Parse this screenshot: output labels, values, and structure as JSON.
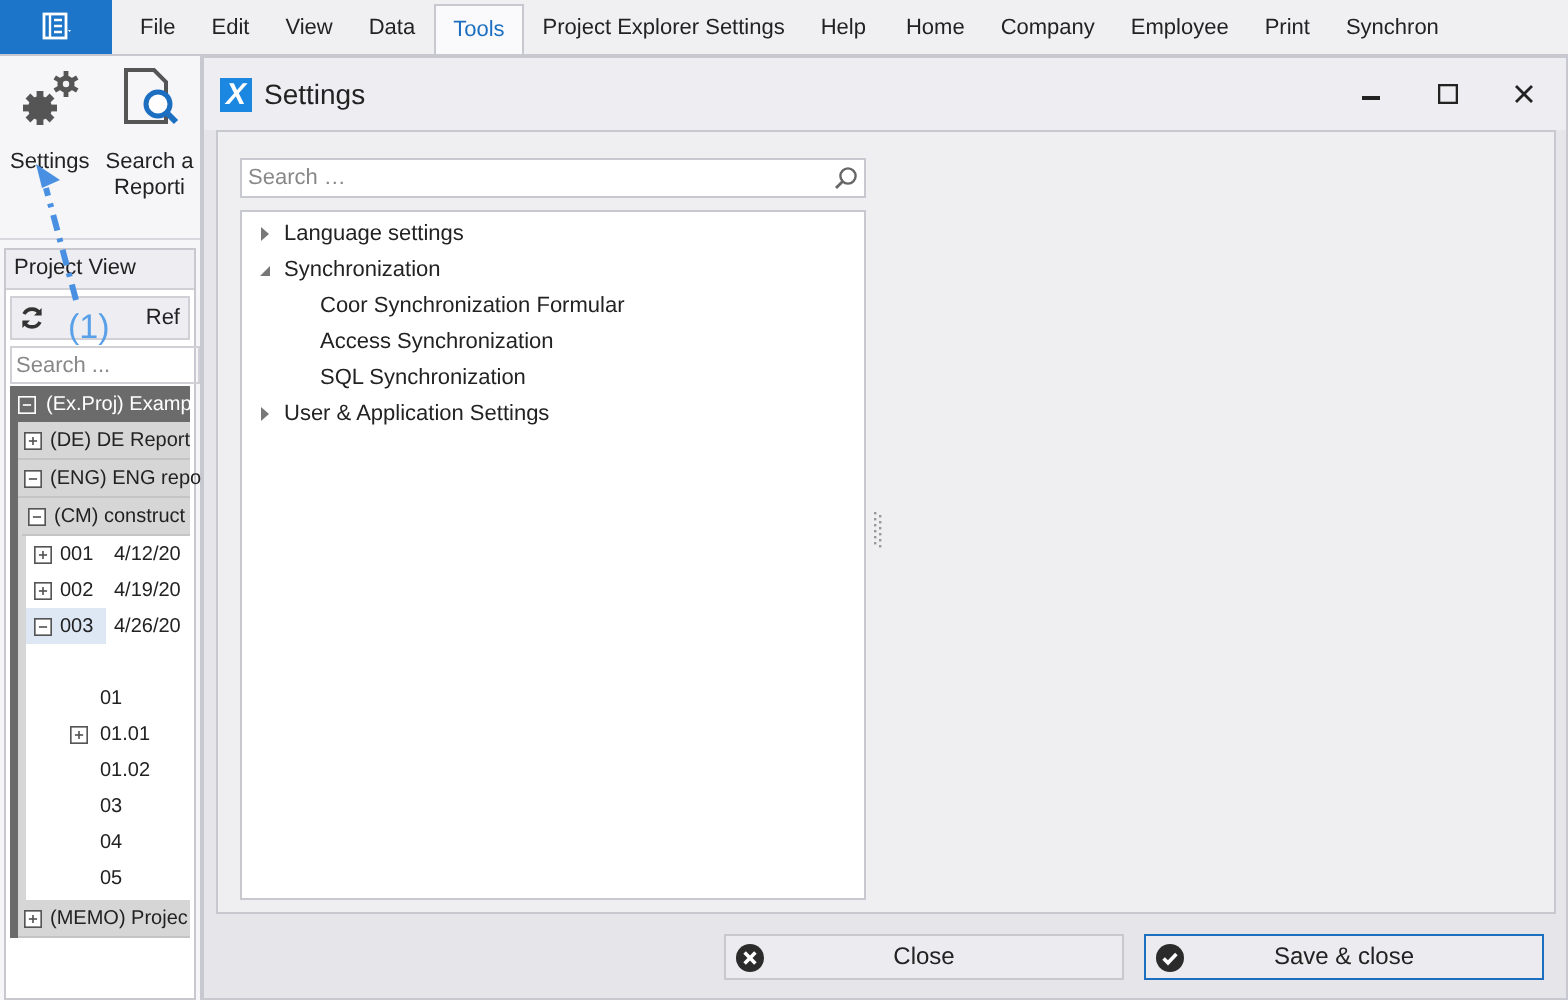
{
  "menu_tabs": [
    {
      "label": "File",
      "selected": false
    },
    {
      "label": "Edit",
      "selected": false
    },
    {
      "label": "View",
      "selected": false
    },
    {
      "label": "Data",
      "selected": false
    },
    {
      "label": "Tools",
      "selected": true
    },
    {
      "label": "Project Explorer Settings",
      "selected": false
    },
    {
      "label": "Help",
      "selected": false
    },
    {
      "label": "Home",
      "selected": false
    },
    {
      "label": "Company",
      "selected": false
    },
    {
      "label": "Employee",
      "selected": false
    },
    {
      "label": "Print",
      "selected": false
    },
    {
      "label": "Synchron",
      "selected": false
    }
  ],
  "ribbon": {
    "buttons": [
      {
        "kind": "settings",
        "lines": [
          "Settings"
        ]
      },
      {
        "kind": "search",
        "lines": [
          "Search a",
          "Reporti"
        ]
      }
    ]
  },
  "annotation": {
    "label": "(1)"
  },
  "project_view": {
    "title": "Project View",
    "toolbar_label": "Ref",
    "search": {
      "placeholder": "Search ..."
    },
    "tree": [
      {
        "label": "(Ex.Proj) Examp",
        "expanded": true,
        "selected": false,
        "children": [
          {
            "label": "(DE) DE Report",
            "expanded": false,
            "selected": false
          },
          {
            "label": "(ENG) ENG repo",
            "expanded": true,
            "selected": false,
            "children": [
              {
                "label": "(CM) construct",
                "expanded": true,
                "selected": false,
                "children": [
                  {
                    "label": "001",
                    "date": "4/12/20",
                    "expanded": false,
                    "selected": false
                  },
                  {
                    "label": "002",
                    "date": "4/19/20",
                    "expanded": false,
                    "selected": false
                  },
                  {
                    "label": "003",
                    "date": "4/26/20",
                    "expanded": true,
                    "selected": true,
                    "children": [
                      {
                        "label": "01",
                        "selected": false
                      },
                      {
                        "label": "01.01",
                        "expanded": false,
                        "selected": false
                      },
                      {
                        "label": "01.02",
                        "selected": false
                      },
                      {
                        "label": "03",
                        "selected": false
                      },
                      {
                        "label": "04",
                        "selected": false
                      },
                      {
                        "label": "05",
                        "selected": false
                      }
                    ]
                  }
                ]
              }
            ]
          },
          {
            "label": "(MEMO) Projec",
            "expanded": false,
            "selected": false
          }
        ]
      }
    ]
  },
  "dialog": {
    "logo_letter": "X",
    "title": "Settings",
    "search": {
      "placeholder": "Search …"
    },
    "tree": [
      {
        "label": "Language settings",
        "expanded": false
      },
      {
        "label": "Synchronization",
        "expanded": true,
        "children": [
          {
            "label": "Coor Synchronization Formular"
          },
          {
            "label": "Access Synchronization"
          },
          {
            "label": "SQL Synchronization"
          }
        ]
      },
      {
        "label": "User & Application Settings",
        "expanded": false
      }
    ],
    "buttons": [
      {
        "kind": "close",
        "label": "Close",
        "focused": false
      },
      {
        "kind": "save",
        "label": "Save & close",
        "focused": true
      }
    ]
  }
}
